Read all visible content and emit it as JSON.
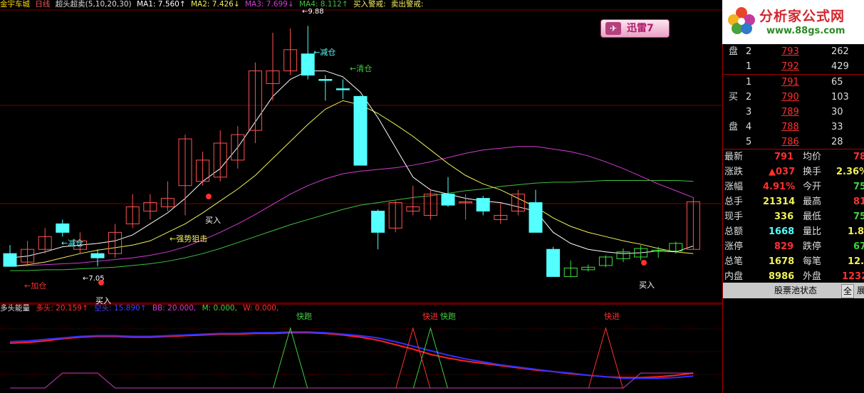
{
  "header": {
    "title": "金宇车城",
    "period": "日线",
    "indicator": "超头超卖(5,10,20,30)",
    "ma1": "MA1: 7.560↑",
    "ma2": "MA2: 7.426↓",
    "ma3": "MA3: 7.699↓",
    "ma4": "MA4: 8.112↑",
    "buy_warn": "买入警戒:",
    "sell_warn": "卖出警戒:"
  },
  "lower_header": {
    "name": "多头能量",
    "duotou": "多头: 20.159↑",
    "kongtou": "空头: 15.890↑",
    "bb": "BB: 20.000,",
    "m": "M: 0.000,",
    "w": "W: 0.000,"
  },
  "colors": {
    "up": "#ff5252",
    "down": "#54ffff",
    "ma1": "#ffffff",
    "ma2": "#f0f05a",
    "ma3": "#d23cd2",
    "ma4": "#40c040",
    "grid": "#7a0000",
    "bull": "#ff2020",
    "bear": "#3030ff",
    "signal_red": "#ff3030",
    "signal_green": "#40d040",
    "signal_purple": "#c040c0"
  },
  "annotations": {
    "jiancang1": "←减仓",
    "jiancang2": "←减仓",
    "qingcang": "←清仓",
    "jiacang": "←加仓",
    "qiangshi": "←强势狙击",
    "mairu1": "买入",
    "mairu2": "买入",
    "mairu3": "买入",
    "high": "9.88",
    "low": "7.05",
    "kuaipao1": "快跑",
    "kuaijin1": "快进",
    "kuaipao2": "快跑",
    "kuaijin2": "快进"
  },
  "ad": {
    "site_name": "分析家公式网",
    "site_url": "www.88gs.com",
    "xunlei": "迅雷7"
  },
  "quote_panel": {
    "sell_label_1": "盘",
    "sell_rows": [
      {
        "level": "2",
        "price": "793",
        "vol": "262"
      },
      {
        "level": "1",
        "price": "792",
        "vol": "429"
      }
    ],
    "buy_label_1": "买",
    "buy_label_2": "盘",
    "buy_rows": [
      {
        "level": "1",
        "price": "791",
        "vol": "65"
      },
      {
        "level": "2",
        "price": "790",
        "vol": "103"
      },
      {
        "level": "3",
        "price": "789",
        "vol": "30"
      },
      {
        "level": "4",
        "price": "788",
        "vol": "33"
      },
      {
        "level": "5",
        "price": "786",
        "vol": "28"
      }
    ],
    "stats": [
      {
        "l1": "最新",
        "v1": "791",
        "l2": "均价",
        "v2": "78"
      },
      {
        "l1": "涨跌",
        "v1": "▲037",
        "l2": "换手",
        "v2": "2.36%"
      },
      {
        "l1": "涨幅",
        "v1": "4.91%",
        "l2": "今开",
        "v2": "75"
      },
      {
        "l1": "总手",
        "v1": "21314",
        "l2": "最高",
        "v2": "81"
      },
      {
        "l1": "现手",
        "v1": "336",
        "l2": "最低",
        "v2": "75"
      },
      {
        "l1": "总额",
        "v1": "1668",
        "l2": "量比",
        "v2": "1.8"
      },
      {
        "l1": "涨停",
        "v1": "829",
        "l2": "跌停",
        "v2": "67"
      },
      {
        "l1": "总笔",
        "v1": "1678",
        "l2": "每笔",
        "v2": "12."
      },
      {
        "l1": "内盘",
        "v1": "8986",
        "l2": "外盘",
        "v2": "1232"
      }
    ],
    "tab_pool": "股票池状态",
    "tab_all": "全",
    "tab_expand": "展"
  },
  "chart_data": [
    {
      "type": "candlestick",
      "title": "超头超卖(5,10,20,30)",
      "ylim": [
        6.9,
        10.0
      ],
      "candles": [
        {
          "o": 7.2,
          "c": 7.05,
          "h": 7.3,
          "l": 7.05
        },
        {
          "o": 7.1,
          "c": 7.25,
          "h": 7.35,
          "l": 7.05
        },
        {
          "o": 7.25,
          "c": 7.4,
          "h": 7.5,
          "l": 7.2
        },
        {
          "o": 7.55,
          "c": 7.45,
          "h": 7.6,
          "l": 7.4
        },
        {
          "o": 7.25,
          "c": 7.35,
          "h": 7.45,
          "l": 7.2
        },
        {
          "o": 7.2,
          "c": 7.15,
          "h": 7.25,
          "l": 7.05
        },
        {
          "o": 7.2,
          "c": 7.45,
          "h": 7.55,
          "l": 7.15
        },
        {
          "o": 7.55,
          "c": 7.75,
          "h": 7.9,
          "l": 7.5
        },
        {
          "o": 7.7,
          "c": 7.8,
          "h": 7.9,
          "l": 7.6
        },
        {
          "o": 7.75,
          "c": 7.85,
          "h": 8.05,
          "l": 7.7
        },
        {
          "o": 8.0,
          "c": 8.55,
          "h": 8.6,
          "l": 7.65
        },
        {
          "o": 8.05,
          "c": 8.3,
          "h": 8.4,
          "l": 8.0
        },
        {
          "o": 8.1,
          "c": 8.5,
          "h": 8.65,
          "l": 8.05
        },
        {
          "o": 8.3,
          "c": 8.6,
          "h": 8.7,
          "l": 8.2
        },
        {
          "o": 8.65,
          "c": 9.35,
          "h": 9.45,
          "l": 8.5
        },
        {
          "o": 9.2,
          "c": 9.35,
          "h": 9.8,
          "l": 9.0
        },
        {
          "o": 9.35,
          "c": 9.6,
          "h": 9.85,
          "l": 9.3
        },
        {
          "o": 9.55,
          "c": 9.3,
          "h": 9.88,
          "l": 9.25
        },
        {
          "o": 9.25,
          "c": 9.24,
          "h": 9.3,
          "l": 9.0
        },
        {
          "o": 9.14,
          "c": 9.13,
          "h": 9.25,
          "l": 9.02
        },
        {
          "o": 9.05,
          "c": 8.24,
          "h": 9.06,
          "l": 8.24
        },
        {
          "o": 7.7,
          "c": 7.45,
          "h": 7.72,
          "l": 7.25
        },
        {
          "o": 7.5,
          "c": 7.8,
          "h": 7.82,
          "l": 7.45
        },
        {
          "o": 7.7,
          "c": 7.75,
          "h": 8.0,
          "l": 7.65
        },
        {
          "o": 7.65,
          "c": 7.9,
          "h": 7.95,
          "l": 7.6
        },
        {
          "o": 7.9,
          "c": 7.77,
          "h": 8.1,
          "l": 7.75
        },
        {
          "o": 7.8,
          "c": 7.81,
          "h": 7.9,
          "l": 7.6
        },
        {
          "o": 7.85,
          "c": 7.7,
          "h": 7.88,
          "l": 7.65
        },
        {
          "o": 7.6,
          "c": 7.65,
          "h": 7.8,
          "l": 7.55
        },
        {
          "o": 7.7,
          "c": 7.9,
          "h": 7.95,
          "l": 7.65
        },
        {
          "o": 7.8,
          "c": 7.45,
          "h": 7.95,
          "l": 7.45
        },
        {
          "o": 7.25,
          "c": 6.93,
          "h": 7.28,
          "l": 6.93
        },
        {
          "o": 6.93,
          "c": 7.03,
          "h": 7.12,
          "l": 6.93
        },
        {
          "o": 7.01,
          "c": 7.04,
          "h": 7.07,
          "l": 6.99
        },
        {
          "o": 7.06,
          "c": 7.16,
          "h": 7.18,
          "l": 7.04
        },
        {
          "o": 7.14,
          "c": 7.22,
          "h": 7.26,
          "l": 7.1
        },
        {
          "o": 7.16,
          "c": 7.26,
          "h": 7.3,
          "l": 7.12
        },
        {
          "o": 7.23,
          "c": 7.24,
          "h": 7.28,
          "l": 7.15
        },
        {
          "o": 7.23,
          "c": 7.32,
          "h": 7.34,
          "l": 7.2
        },
        {
          "o": 7.25,
          "c": 7.81,
          "h": 7.86,
          "l": 7.25
        }
      ],
      "ma1": [
        7.15,
        7.17,
        7.22,
        7.28,
        7.3,
        7.32,
        7.35,
        7.42,
        7.55,
        7.68,
        7.85,
        8.05,
        8.2,
        8.45,
        8.75,
        9.05,
        9.25,
        9.35,
        9.35,
        9.28,
        9.1,
        8.8,
        8.45,
        8.1,
        7.95,
        7.9,
        7.85,
        7.82,
        7.8,
        7.75,
        7.7,
        7.45,
        7.32,
        7.25,
        7.22,
        7.2,
        7.21,
        7.23,
        7.22,
        7.29
      ],
      "ma2": [
        7.05,
        7.07,
        7.1,
        7.15,
        7.2,
        7.24,
        7.27,
        7.3,
        7.35,
        7.45,
        7.55,
        7.68,
        7.82,
        7.96,
        8.12,
        8.32,
        8.52,
        8.72,
        8.9,
        9.0,
        8.95,
        8.85,
        8.72,
        8.58,
        8.42,
        8.26,
        8.12,
        8.02,
        7.95,
        7.85,
        7.75,
        7.62,
        7.52,
        7.45,
        7.4,
        7.35,
        7.31,
        7.26,
        7.22,
        7.2
      ],
      "ma3": [
        7.05,
        7.06,
        7.07,
        7.08,
        7.09,
        7.11,
        7.13,
        7.15,
        7.18,
        7.22,
        7.28,
        7.36,
        7.45,
        7.55,
        7.66,
        7.78,
        7.9,
        8.0,
        8.08,
        8.14,
        8.17,
        8.19,
        8.21,
        8.24,
        8.28,
        8.33,
        8.38,
        8.42,
        8.44,
        8.46,
        8.46,
        8.43,
        8.4,
        8.35,
        8.28,
        8.2,
        8.11,
        8.02,
        7.94,
        7.86
      ],
      "ma4": [
        7.0,
        7.0,
        7.01,
        7.01,
        7.02,
        7.03,
        7.04,
        7.06,
        7.08,
        7.11,
        7.15,
        7.2,
        7.26,
        7.33,
        7.4,
        7.47,
        7.54,
        7.6,
        7.66,
        7.72,
        7.77,
        7.8,
        7.83,
        7.86,
        7.88,
        7.91,
        7.94,
        7.96,
        7.99,
        8.01,
        8.03,
        8.04,
        8.04,
        8.05,
        8.06,
        8.06,
        8.06,
        8.06,
        8.06,
        8.05
      ]
    },
    {
      "type": "line",
      "title": "多头能量",
      "ylim": [
        0,
        100
      ],
      "series": [
        {
          "name": "多头",
          "values": [
            60,
            61,
            63,
            66,
            68,
            69,
            69,
            68,
            68,
            69,
            70,
            71,
            72,
            72,
            73,
            73,
            74,
            74,
            73,
            71,
            68,
            64,
            58,
            52,
            45,
            40,
            36,
            33,
            30,
            27,
            24,
            22,
            19,
            17,
            15,
            14,
            14,
            15,
            17,
            20
          ]
        },
        {
          "name": "空头",
          "values": [
            62,
            63,
            65,
            67,
            69,
            70,
            70,
            69,
            69,
            70,
            71,
            72,
            73,
            73,
            74,
            74,
            75,
            75,
            74,
            72,
            70,
            67,
            62,
            56,
            50,
            44,
            39,
            35,
            31,
            28,
            25,
            22,
            20,
            17,
            15,
            13,
            13,
            13,
            14,
            16
          ]
        },
        {
          "name": "BB",
          "values": [
            0,
            0,
            0,
            20,
            20,
            20,
            0,
            0,
            0,
            0,
            0,
            0,
            0,
            0,
            0,
            0,
            0,
            0,
            0,
            0,
            0,
            0,
            0,
            0,
            0,
            0,
            0,
            0,
            0,
            0,
            0,
            0,
            0,
            0,
            0,
            0,
            20,
            20,
            20,
            20
          ]
        },
        {
          "name": "快跑",
          "values": [
            0,
            0,
            0,
            0,
            0,
            0,
            0,
            0,
            0,
            0,
            0,
            0,
            0,
            0,
            0,
            0,
            80,
            0,
            0,
            0,
            0,
            0,
            0,
            0,
            80,
            0,
            0,
            0,
            0,
            0,
            0,
            0,
            0,
            0,
            0,
            0,
            0,
            0,
            0,
            0
          ]
        },
        {
          "name": "快进",
          "values": [
            0,
            0,
            0,
            0,
            0,
            0,
            0,
            0,
            0,
            0,
            0,
            0,
            0,
            0,
            0,
            0,
            0,
            0,
            0,
            0,
            0,
            0,
            0,
            80,
            0,
            0,
            0,
            0,
            0,
            0,
            0,
            0,
            0,
            0,
            80,
            0,
            0,
            0,
            0,
            0
          ]
        }
      ]
    }
  ]
}
